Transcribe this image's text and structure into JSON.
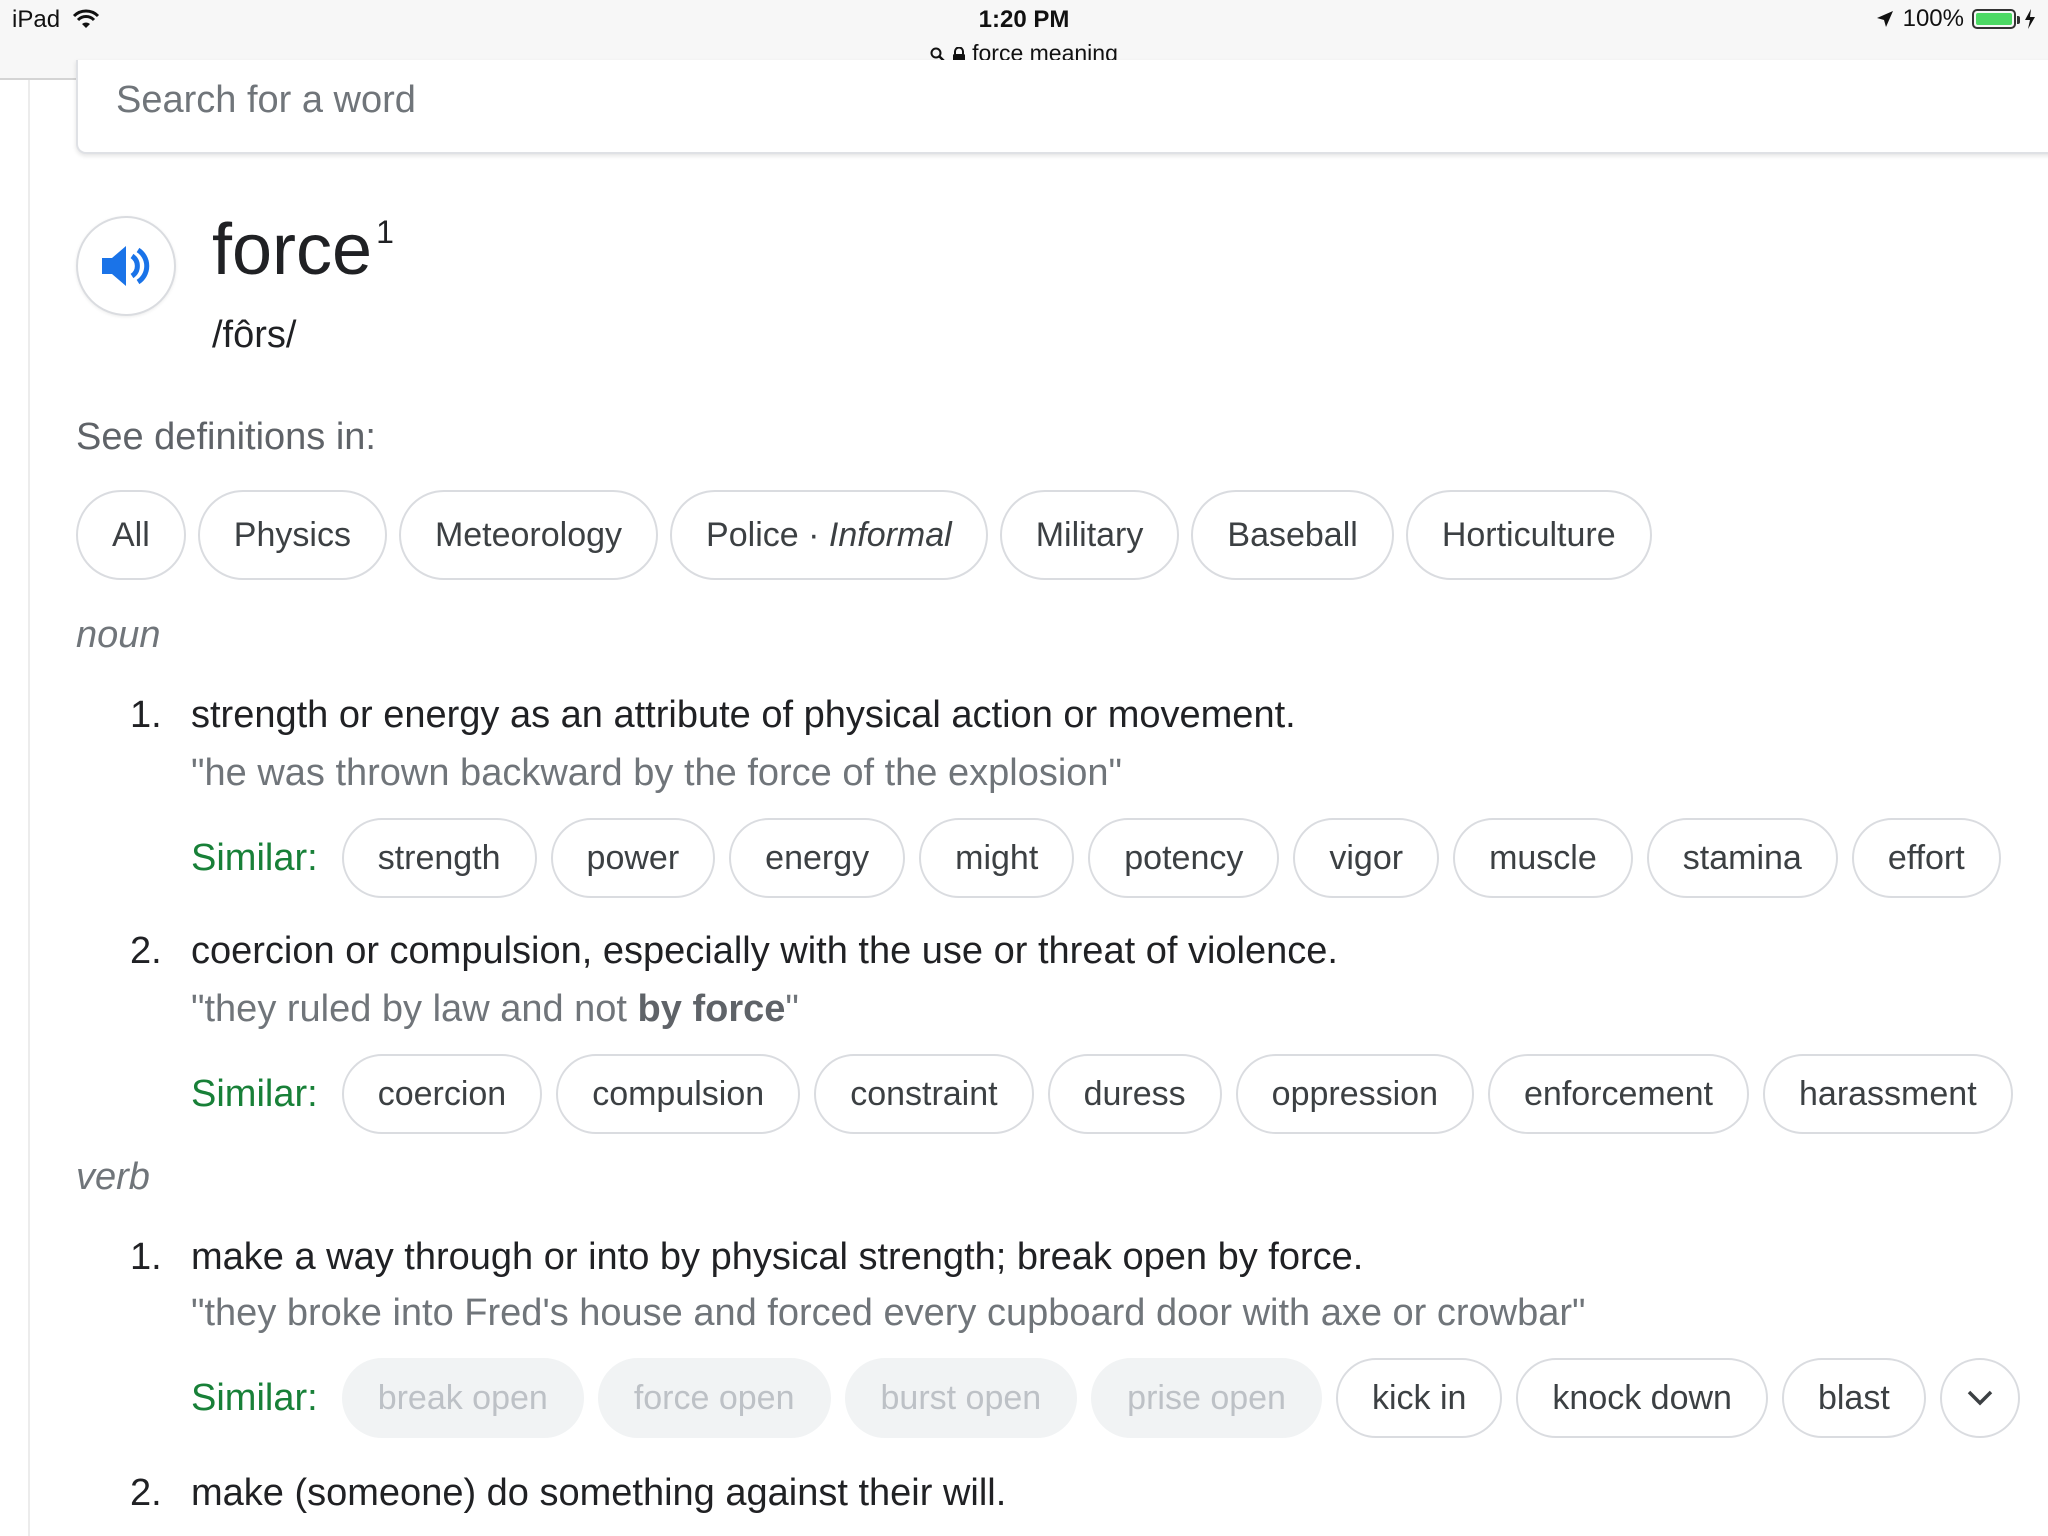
{
  "status_bar": {
    "device": "iPad",
    "time": "1:20 PM",
    "url": "force meaning",
    "battery": "100%"
  },
  "search": {
    "placeholder": "Search for a word"
  },
  "entry": {
    "word": "force",
    "superscript": "1",
    "phonetic": "/fôrs/"
  },
  "see_definitions": {
    "label": "See definitions in:",
    "chips": [
      "All",
      "Physics",
      "Meteorology",
      "Police",
      "Military",
      "Baseball",
      "Horticulture"
    ],
    "police_qualifier": "Informal",
    "separator": "·"
  },
  "noun": {
    "label": "noun",
    "senses": [
      {
        "num": "1.",
        "definition": "strength or energy as an attribute of physical action or movement.",
        "example": "\"he was thrown backward by the force of the explosion\"",
        "similar_label": "Similar:",
        "similar": [
          "strength",
          "power",
          "energy",
          "might",
          "potency",
          "vigor",
          "muscle",
          "stamina",
          "effort"
        ]
      },
      {
        "num": "2.",
        "definition": "coercion or compulsion, especially with the use or threat of violence.",
        "example_pre": "\"they ruled by law and not ",
        "example_bold": "by force",
        "example_post": "\"",
        "similar_label": "Similar:",
        "similar": [
          "coercion",
          "compulsion",
          "constraint",
          "duress",
          "oppression",
          "enforcement",
          "harassment"
        ]
      }
    ]
  },
  "verb": {
    "label": "verb",
    "senses": [
      {
        "num": "1.",
        "definition": "make a way through or into by physical strength; break open by force.",
        "example": "\"they broke into Fred's house and forced every cupboard door with axe or crowbar\"",
        "similar_label": "Similar:",
        "similar_muted": [
          "break open",
          "force open",
          "burst open",
          "prise open"
        ],
        "similar": [
          "kick in",
          "knock down",
          "blast"
        ]
      },
      {
        "num": "2.",
        "definition": "make (someone) do something against their will."
      }
    ]
  },
  "colors": {
    "similar_label": "#188038",
    "speaker_icon": "#1a73e8",
    "chip_border": "#dadce0"
  }
}
